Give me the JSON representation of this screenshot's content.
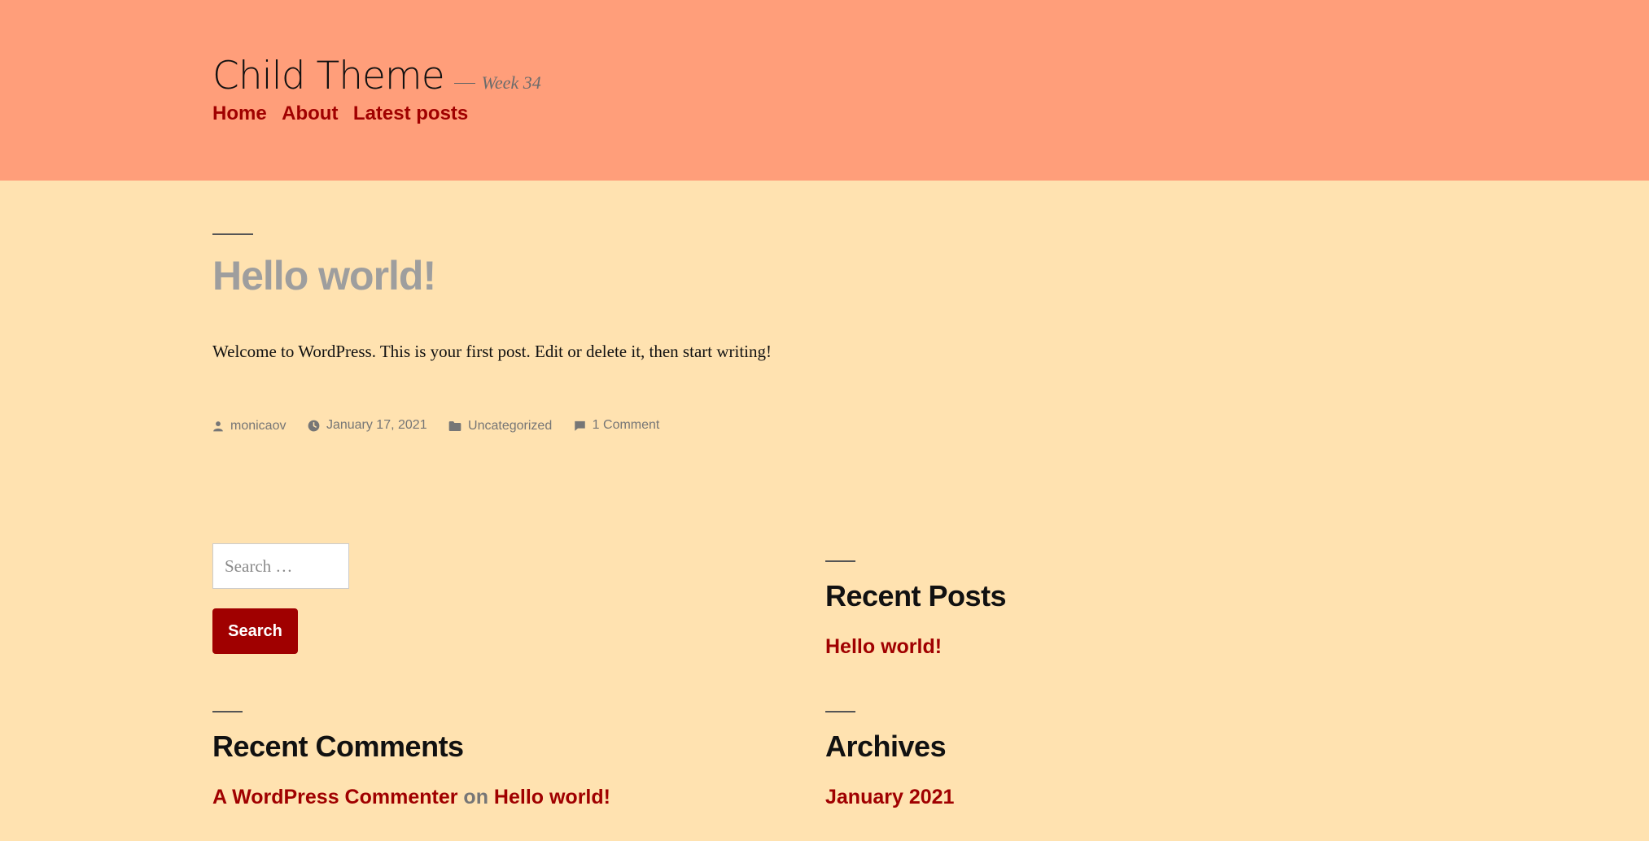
{
  "site": {
    "title": "Child Theme",
    "description": "Week 34"
  },
  "nav": {
    "items": [
      "Home",
      "About",
      "Latest posts"
    ]
  },
  "post": {
    "title": "Hello world!",
    "body": "Welcome to WordPress. This is your first post. Edit or delete it, then start writing!",
    "meta": {
      "author": "monicaov",
      "date": "January 17, 2021",
      "category": "Uncategorized",
      "comments": "1 Comment"
    }
  },
  "search": {
    "placeholder": "Search …",
    "button_label": "Search"
  },
  "widgets": {
    "recent_posts": {
      "title": "Recent Posts",
      "items": [
        "Hello world!"
      ]
    },
    "recent_comments": {
      "title": "Recent Comments",
      "author": "A WordPress Commenter",
      "connector": "on",
      "post": "Hello world!"
    },
    "archives": {
      "title": "Archives",
      "items": [
        "January 2021"
      ]
    }
  },
  "colors": {
    "header_bg": "#ff9e7a",
    "page_bg": "#ffe2b0",
    "accent": "#a00000"
  }
}
